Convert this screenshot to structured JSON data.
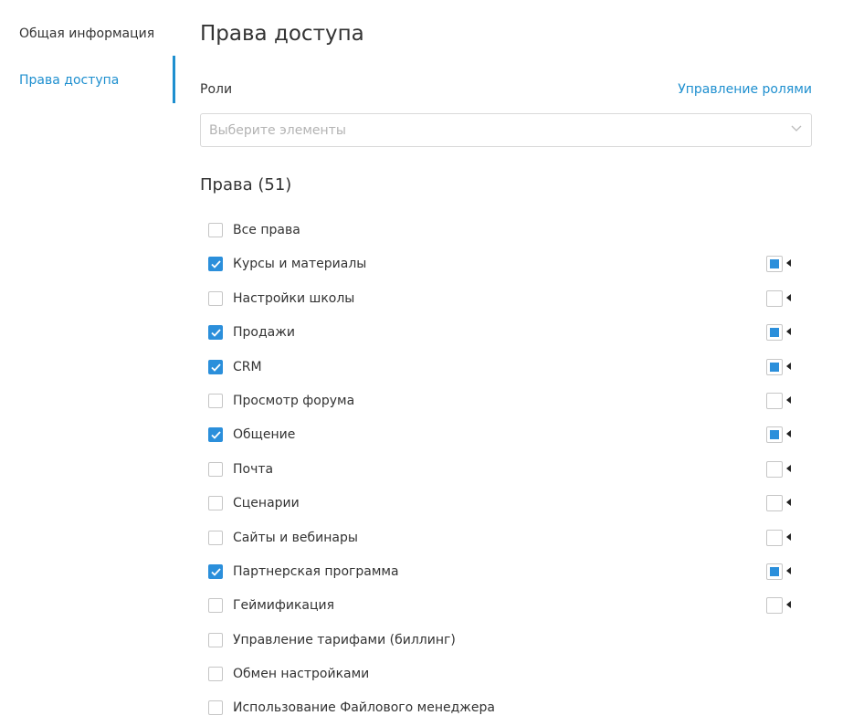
{
  "sidebar": {
    "items": [
      {
        "label": "Общая информация",
        "active": false
      },
      {
        "label": "Права доступа",
        "active": true
      }
    ]
  },
  "main": {
    "title": "Права доступа",
    "roles_label": "Роли",
    "manage_roles_link": "Управление ролями",
    "roles_select": {
      "placeholder": "Выберите элементы",
      "value": ""
    },
    "permissions_title": "Права (51)",
    "permissions": [
      {
        "label": "Все права",
        "checked": false,
        "sub": null
      },
      {
        "label": "Курсы и материалы",
        "checked": true,
        "sub": "partial"
      },
      {
        "label": "Настройки школы",
        "checked": false,
        "sub": "empty"
      },
      {
        "label": "Продажи",
        "checked": true,
        "sub": "partial"
      },
      {
        "label": "CRM",
        "checked": true,
        "sub": "partial"
      },
      {
        "label": "Просмотр форума",
        "checked": false,
        "sub": "empty"
      },
      {
        "label": "Общение",
        "checked": true,
        "sub": "partial"
      },
      {
        "label": "Почта",
        "checked": false,
        "sub": "empty"
      },
      {
        "label": "Сценарии",
        "checked": false,
        "sub": "empty"
      },
      {
        "label": "Сайты и вебинары",
        "checked": false,
        "sub": "empty"
      },
      {
        "label": "Партнерская программа",
        "checked": true,
        "sub": "partial"
      },
      {
        "label": "Геймификация",
        "checked": false,
        "sub": "empty"
      },
      {
        "label": "Управление тарифами (биллинг)",
        "checked": false,
        "sub": null
      },
      {
        "label": "Обмен настройками",
        "checked": false,
        "sub": null
      },
      {
        "label": "Использование Файлового менеджера",
        "checked": false,
        "sub": null
      }
    ]
  },
  "colors": {
    "accent": "#1e8fcf",
    "checkbox_checked": "#2b8fdb",
    "text": "#333333",
    "placeholder": "#b3b3b3"
  },
  "icons": {
    "select": "chevron-down-icon",
    "checkbox": "checkmark-icon",
    "expand": "caret-left-icon"
  }
}
